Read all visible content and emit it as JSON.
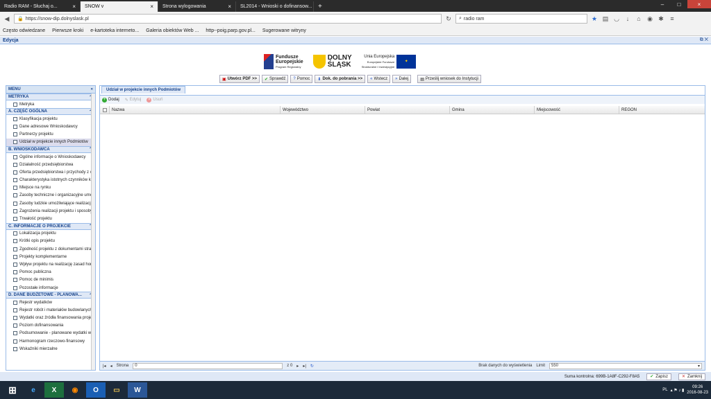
{
  "browser": {
    "tabs": [
      {
        "label": "Radio RAM - Słuchaj o..."
      },
      {
        "label": "SNOW v",
        "active": true
      },
      {
        "label": "Strona wylogowania"
      },
      {
        "label": "SL2014 - Wnioski o dofinansow..."
      }
    ],
    "url": "https://snow-dip.dolnyslask.pl",
    "search": "radio ram",
    "bookmarks": [
      "Często odwiedzane",
      "Pierwsze kroki",
      "e-kartoteka internetо...",
      "Galeria obiektów Web ...",
      "http--poig.parp.gov.pl...",
      "Sugerowane witryny"
    ]
  },
  "app": {
    "title": "Edycja",
    "logos": {
      "fe": [
        "Fundusze",
        "Europejskie",
        "Program Regionalny"
      ],
      "ds": [
        "DOLNY",
        "ŚLĄSK"
      ],
      "ue": [
        "Unia Europejska",
        "Europejskie Fundusze",
        "Strukturalne i Inwestycyjne"
      ]
    },
    "toolbar": [
      {
        "label": "Utwórz PDF >>",
        "icon": "pdf-icon"
      },
      {
        "label": "Sprawdź",
        "icon": "check-icon"
      },
      {
        "label": "Pomoc",
        "icon": "help-icon"
      },
      {
        "label": "Dok. do pobrania >>",
        "icon": "download-icon"
      },
      {
        "label": "Wstecz",
        "icon": "back-icon"
      },
      {
        "label": "Dalej",
        "icon": "forward-icon"
      },
      {
        "label": "Prześlij wniosek do Instytucji",
        "icon": "send-icon"
      }
    ]
  },
  "sidebar": {
    "title": "MENU",
    "sections": [
      {
        "title": "METRYKA",
        "items": [
          "Metryka"
        ]
      },
      {
        "title": "A. CZĘŚĆ OGÓLNA",
        "items": [
          "Klasyfikacja projektu",
          "Dane adresowe Wnioskodawcy",
          "Partnerzy projektu",
          "Udział w projekcie innych Podmiotów"
        ]
      },
      {
        "title": "B. WNIOSKODAWCA",
        "items": [
          "Ogólne informacje o Wnioskodawcy",
          "Działalność przedsiębiorstwa",
          "Oferta przedsiębiorstwa i przychody z o",
          "Charakterystyka istotnych czynników k",
          "Miejsce na rynku",
          "Zasoby techniczne i organizacyjne umo",
          "Zasoby ludzkie umożliwiające realizację",
          "Zagrożenia realizacji projektu i sposoby",
          "Trwałość projektu"
        ]
      },
      {
        "title": "C. INFORMACJE O PROJEKCIE",
        "items": [
          "Lokalizacja projektu",
          "Krótki opis projektu",
          "Zgodność projektu z dokumentami stra",
          "Projekty komplementarne",
          "Wpływ projektu na realizację zasad hor",
          "Pomoc publiczna",
          "Pomoc de minimis",
          "Pozostałe informacje"
        ]
      },
      {
        "title": "D. DANE BUDŻETOWE - PLANOWA...",
        "items": [
          "Rejestr wydatków",
          "Rejestr robót i materiałów budowlanych",
          "Wydatki oraz źródła finansowania proje",
          "Poziom dofinansowania",
          "Podsumowanie - planowane wydatki w",
          "Harmonogram rzeczowo-finansowy",
          "Wskaźniki mierzalne"
        ]
      }
    ]
  },
  "panel": {
    "tab": "Udział w projekcie innych Podmiotów",
    "actions": {
      "add": "Dodaj",
      "edit": "Edytuj",
      "delete": "Usuń"
    },
    "columns": [
      "Nazwa",
      "Województwo",
      "Powiat",
      "Gmina",
      "Miejscowość",
      "REGON"
    ],
    "pager": {
      "page_label": "Strona",
      "page": "0",
      "of": "z 0",
      "empty": "Brak danych do wyświetlenia",
      "limit_label": "Limit",
      "limit": "550"
    }
  },
  "footer": {
    "checksum": "Suma kontrolna: 699B-1A8F-C292-F8A5",
    "save": "Zapisz",
    "close": "Zamknij"
  },
  "taskbar": {
    "lang": "PL",
    "time": "09:26",
    "date": "2016-08-23"
  }
}
